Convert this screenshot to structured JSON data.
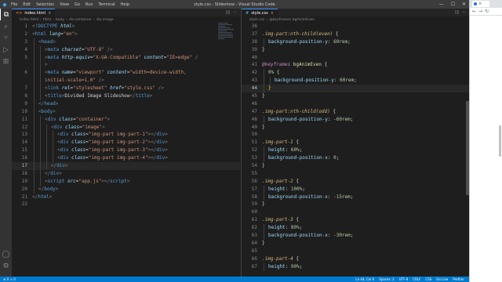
{
  "titlebar": {
    "logo_icon": "vscode-logo-icon",
    "menu": [
      "File",
      "Edit",
      "Selection",
      "View",
      "Go",
      "Run",
      "Terminal",
      "Help"
    ],
    "title": "style.css - Slideshow - Visual Studio Code",
    "controls": [
      "minimize-icon",
      "maximize-icon",
      "close-icon"
    ]
  },
  "activity_bar": {
    "top": [
      "files-icon",
      "search-icon",
      "source-control-icon",
      "run-debug-icon",
      "extensions-icon"
    ],
    "bottom": [
      "account-icon",
      "settings-gear-icon"
    ]
  },
  "left_editor": {
    "tab": {
      "icon_label": "<>",
      "label": "index.html"
    },
    "breadcrumbs": [
      "index.html",
      "html",
      "body",
      "div.container",
      "div.image"
    ],
    "current_line": 17,
    "lines": [
      {
        "n": 1,
        "indent": 0,
        "tokens": [
          [
            "p",
            "<!"
          ],
          [
            "t",
            "DOCTYPE"
          ],
          [
            "w",
            " "
          ],
          [
            "a",
            "html"
          ],
          [
            "p",
            ">"
          ]
        ]
      },
      {
        "n": 2,
        "indent": 0,
        "tokens": [
          [
            "p",
            "<"
          ],
          [
            "t",
            "html"
          ],
          [
            "w",
            " "
          ],
          [
            "a",
            "lang"
          ],
          [
            "w",
            "="
          ],
          [
            "s",
            "\"en\""
          ],
          [
            "p",
            ">"
          ]
        ]
      },
      {
        "n": 3,
        "indent": 1,
        "tokens": [
          [
            "p",
            "<"
          ],
          [
            "t",
            "head"
          ],
          [
            "p",
            ">"
          ]
        ]
      },
      {
        "n": 4,
        "indent": 2,
        "tokens": [
          [
            "p",
            "<"
          ],
          [
            "t",
            "meta"
          ],
          [
            "w",
            " "
          ],
          [
            "a",
            "charset"
          ],
          [
            "w",
            "="
          ],
          [
            "s",
            "\"UTF-8\""
          ],
          [
            "w",
            " "
          ],
          [
            "p",
            "/>"
          ]
        ]
      },
      {
        "n": 5,
        "indent": 2,
        "tokens": [
          [
            "p",
            "<"
          ],
          [
            "t",
            "meta"
          ],
          [
            "w",
            " "
          ],
          [
            "a",
            "http-equiv"
          ],
          [
            "w",
            "="
          ],
          [
            "s",
            "\"X-UA-Compatible\""
          ],
          [
            "w",
            " "
          ],
          [
            "a",
            "content"
          ],
          [
            "w",
            "="
          ],
          [
            "s",
            "\"IE=edge\""
          ],
          [
            "w",
            " "
          ],
          [
            "p",
            "/"
          ]
        ]
      },
      {
        "n": "",
        "indent": 2,
        "tokens": [
          [
            "p",
            ">"
          ]
        ]
      },
      {
        "n": 6,
        "indent": 2,
        "tokens": [
          [
            "p",
            "<"
          ],
          [
            "t",
            "meta"
          ],
          [
            "w",
            " "
          ],
          [
            "a",
            "name"
          ],
          [
            "w",
            "="
          ],
          [
            "s",
            "\"viewport\""
          ],
          [
            "w",
            " "
          ],
          [
            "a",
            "content"
          ],
          [
            "w",
            "="
          ],
          [
            "s",
            "\"width=device-width,"
          ]
        ]
      },
      {
        "n": "",
        "indent": 2,
        "tokens": [
          [
            "s",
            "initial-scale=1.0\""
          ],
          [
            "w",
            " "
          ],
          [
            "p",
            "/>"
          ]
        ]
      },
      {
        "n": 7,
        "indent": 2,
        "tokens": [
          [
            "p",
            "<"
          ],
          [
            "t",
            "link"
          ],
          [
            "w",
            " "
          ],
          [
            "a",
            "rel"
          ],
          [
            "w",
            "="
          ],
          [
            "s",
            "\"stylesheet\""
          ],
          [
            "w",
            " "
          ],
          [
            "a",
            "href"
          ],
          [
            "w",
            "="
          ],
          [
            "s",
            "\"style.css\""
          ],
          [
            "w",
            " "
          ],
          [
            "p",
            "/>"
          ]
        ]
      },
      {
        "n": 8,
        "indent": 2,
        "tokens": [
          [
            "p",
            "<"
          ],
          [
            "t",
            "title"
          ],
          [
            "p",
            ">"
          ],
          [
            "w",
            "Divided Image Slideshow"
          ],
          [
            "p",
            "</"
          ],
          [
            "t",
            "title"
          ],
          [
            "p",
            ">"
          ]
        ]
      },
      {
        "n": 9,
        "indent": 1,
        "tokens": [
          [
            "p",
            "</"
          ],
          [
            "t",
            "head"
          ],
          [
            "p",
            ">"
          ]
        ]
      },
      {
        "n": 10,
        "indent": 1,
        "tokens": [
          [
            "p",
            "<"
          ],
          [
            "t",
            "body"
          ],
          [
            "p",
            ">"
          ]
        ]
      },
      {
        "n": 11,
        "indent": 2,
        "tokens": [
          [
            "p",
            "<"
          ],
          [
            "t",
            "div"
          ],
          [
            "w",
            " "
          ],
          [
            "a",
            "class"
          ],
          [
            "w",
            "="
          ],
          [
            "s",
            "\"container\""
          ],
          [
            "p",
            ">"
          ]
        ]
      },
      {
        "n": 12,
        "indent": 3,
        "tokens": [
          [
            "p",
            "<"
          ],
          [
            "t",
            "div"
          ],
          [
            "w",
            " "
          ],
          [
            "a",
            "class"
          ],
          [
            "w",
            "="
          ],
          [
            "s",
            "\"image\""
          ],
          [
            "p",
            ">"
          ]
        ]
      },
      {
        "n": 13,
        "indent": 4,
        "tokens": [
          [
            "p",
            "<"
          ],
          [
            "t",
            "div"
          ],
          [
            "w",
            " "
          ],
          [
            "a",
            "class"
          ],
          [
            "w",
            "="
          ],
          [
            "s",
            "\"img-part img-part-1\""
          ],
          [
            "p",
            "></"
          ],
          [
            "t",
            "div"
          ],
          [
            "p",
            ">"
          ]
        ]
      },
      {
        "n": 14,
        "indent": 4,
        "tokens": [
          [
            "p",
            "<"
          ],
          [
            "t",
            "div"
          ],
          [
            "w",
            " "
          ],
          [
            "a",
            "class"
          ],
          [
            "w",
            "="
          ],
          [
            "s",
            "\"img-part img-part-2\""
          ],
          [
            "p",
            "></"
          ],
          [
            "t",
            "div"
          ],
          [
            "p",
            ">"
          ]
        ]
      },
      {
        "n": 15,
        "indent": 4,
        "tokens": [
          [
            "p",
            "<"
          ],
          [
            "t",
            "div"
          ],
          [
            "w",
            " "
          ],
          [
            "a",
            "class"
          ],
          [
            "w",
            "="
          ],
          [
            "s",
            "\"img-part img-part-3\""
          ],
          [
            "p",
            "></"
          ],
          [
            "t",
            "div"
          ],
          [
            "p",
            ">"
          ]
        ]
      },
      {
        "n": 16,
        "indent": 4,
        "tokens": [
          [
            "p",
            "<"
          ],
          [
            "t",
            "div"
          ],
          [
            "w",
            " "
          ],
          [
            "a",
            "class"
          ],
          [
            "w",
            "="
          ],
          [
            "s",
            "\"img-part img-part-4\""
          ],
          [
            "p",
            "></"
          ],
          [
            "t",
            "div"
          ],
          [
            "p",
            ">"
          ]
        ]
      },
      {
        "n": 17,
        "indent": 3,
        "tokens": [
          [
            "p",
            "</"
          ],
          [
            "t",
            "div"
          ],
          [
            "p",
            ">"
          ]
        ]
      },
      {
        "n": 18,
        "indent": 2,
        "tokens": [
          [
            "p",
            "</"
          ],
          [
            "t",
            "div"
          ],
          [
            "p",
            ">"
          ]
        ]
      },
      {
        "n": 19,
        "indent": 2,
        "tokens": [
          [
            "p",
            "<"
          ],
          [
            "t",
            "script"
          ],
          [
            "w",
            " "
          ],
          [
            "a",
            "src"
          ],
          [
            "w",
            "="
          ],
          [
            "s",
            "\"app.js\""
          ],
          [
            "p",
            "></"
          ],
          [
            "t",
            "script"
          ],
          [
            "p",
            ">"
          ]
        ]
      },
      {
        "n": 20,
        "indent": 1,
        "tokens": [
          [
            "p",
            "</"
          ],
          [
            "t",
            "body"
          ],
          [
            "p",
            ">"
          ]
        ]
      },
      {
        "n": 21,
        "indent": 0,
        "tokens": [
          [
            "p",
            "</"
          ],
          [
            "t",
            "html"
          ],
          [
            "p",
            ">"
          ]
        ]
      },
      {
        "n": 22,
        "indent": 0,
        "tokens": []
      }
    ]
  },
  "right_editor": {
    "tab": {
      "icon_label": "#",
      "label": "style.css"
    },
    "breadcrumbs": [
      "style.css",
      "@keyframes bgAnimEven"
    ],
    "current_line": 44,
    "lines": [
      {
        "n": 36,
        "indent": 0,
        "tokens": []
      },
      {
        "n": 37,
        "indent": 0,
        "tokens": [
          [
            "sel",
            ".img-part:nth-child(even)"
          ],
          [
            "w",
            " {"
          ]
        ]
      },
      {
        "n": 38,
        "indent": 1,
        "tokens": [
          [
            "pr",
            "background-position-y"
          ],
          [
            "w",
            ": "
          ],
          [
            "n",
            "60rem"
          ],
          [
            "w",
            ";"
          ]
        ]
      },
      {
        "n": 39,
        "indent": 0,
        "tokens": [
          [
            "w",
            "}"
          ]
        ]
      },
      {
        "n": 40,
        "indent": 0,
        "tokens": []
      },
      {
        "n": 41,
        "indent": 0,
        "tokens": [
          [
            "k",
            "@keyframes"
          ],
          [
            "w",
            " "
          ],
          [
            "fn",
            "bgAnimEven"
          ],
          [
            "w",
            " {"
          ]
        ]
      },
      {
        "n": 42,
        "indent": 1,
        "tokens": [
          [
            "n",
            "0%"
          ],
          [
            "w",
            " {"
          ]
        ]
      },
      {
        "n": 43,
        "indent": 2,
        "tokens": [
          [
            "pr",
            "background-position-y"
          ],
          [
            "w",
            ": "
          ],
          [
            "n",
            "60rem"
          ],
          [
            "w",
            ";"
          ]
        ]
      },
      {
        "n": 44,
        "indent": 1,
        "tokens": [
          [
            "br",
            "}"
          ]
        ]
      },
      {
        "n": 45,
        "indent": 0,
        "tokens": [
          [
            "w",
            "}"
          ]
        ]
      },
      {
        "n": 46,
        "indent": 0,
        "tokens": []
      },
      {
        "n": 47,
        "indent": 0,
        "tokens": [
          [
            "sel",
            ".img-part:nth-child(odd)"
          ],
          [
            "w",
            " {"
          ]
        ]
      },
      {
        "n": 48,
        "indent": 1,
        "tokens": [
          [
            "pr",
            "background-position-y"
          ],
          [
            "w",
            ": "
          ],
          [
            "n",
            "-60rem"
          ],
          [
            "w",
            ";"
          ]
        ]
      },
      {
        "n": 49,
        "indent": 0,
        "tokens": [
          [
            "w",
            "}"
          ]
        ]
      },
      {
        "n": 50,
        "indent": 0,
        "tokens": []
      },
      {
        "n": 51,
        "indent": 0,
        "tokens": [
          [
            "sel",
            ".img-part-1"
          ],
          [
            "w",
            " {"
          ]
        ]
      },
      {
        "n": 52,
        "indent": 1,
        "tokens": [
          [
            "pr",
            "height"
          ],
          [
            "w",
            ": "
          ],
          [
            "n",
            "60%"
          ],
          [
            "w",
            ";"
          ]
        ]
      },
      {
        "n": 53,
        "indent": 1,
        "tokens": [
          [
            "pr",
            "background-position-x"
          ],
          [
            "w",
            ": "
          ],
          [
            "n",
            "0"
          ],
          [
            "w",
            ";"
          ]
        ]
      },
      {
        "n": 54,
        "indent": 0,
        "tokens": [
          [
            "w",
            "}"
          ]
        ]
      },
      {
        "n": 55,
        "indent": 0,
        "tokens": []
      },
      {
        "n": 56,
        "indent": 0,
        "tokens": [
          [
            "sel",
            ".img-part-2"
          ],
          [
            "w",
            " {"
          ]
        ]
      },
      {
        "n": 57,
        "indent": 1,
        "tokens": [
          [
            "pr",
            "height"
          ],
          [
            "w",
            ": "
          ],
          [
            "n",
            "100%"
          ],
          [
            "w",
            ";"
          ]
        ]
      },
      {
        "n": 58,
        "indent": 1,
        "tokens": [
          [
            "pr",
            "background-position-x"
          ],
          [
            "w",
            ": "
          ],
          [
            "n",
            "-15rem"
          ],
          [
            "w",
            ";"
          ]
        ]
      },
      {
        "n": 59,
        "indent": 0,
        "tokens": [
          [
            "w",
            "}"
          ]
        ]
      },
      {
        "n": 60,
        "indent": 0,
        "tokens": []
      },
      {
        "n": 61,
        "indent": 0,
        "tokens": [
          [
            "sel",
            ".img-part-3"
          ],
          [
            "w",
            " {"
          ]
        ]
      },
      {
        "n": 62,
        "indent": 1,
        "tokens": [
          [
            "pr",
            "height"
          ],
          [
            "w",
            ": "
          ],
          [
            "n",
            "80%"
          ],
          [
            "w",
            ";"
          ]
        ]
      },
      {
        "n": 63,
        "indent": 1,
        "tokens": [
          [
            "pr",
            "background-position-x"
          ],
          [
            "w",
            ": "
          ],
          [
            "n",
            "-30rem"
          ],
          [
            "w",
            ";"
          ]
        ]
      },
      {
        "n": 64,
        "indent": 0,
        "tokens": [
          [
            "w",
            "}"
          ]
        ]
      },
      {
        "n": 65,
        "indent": 0,
        "tokens": []
      },
      {
        "n": 66,
        "indent": 0,
        "tokens": [
          [
            "sel",
            ".img-part-4"
          ],
          [
            "w",
            " {"
          ]
        ]
      },
      {
        "n": 67,
        "indent": 1,
        "tokens": [
          [
            "pr",
            "height"
          ],
          [
            "w",
            ": "
          ],
          [
            "n",
            "90%"
          ],
          [
            "w",
            ";"
          ]
        ]
      }
    ]
  },
  "statusbar": {
    "left": [
      "⊗ 0 ⚠ 0"
    ],
    "right": [
      "Ln 44, Col 6",
      "Spaces: 2",
      "UTF-8",
      "CRLF",
      "CSS",
      "Go Live",
      "Prettier"
    ]
  },
  "browser": {
    "tab_label": "",
    "nav": [
      "back-icon",
      "forward-icon",
      "reload-icon"
    ]
  },
  "colors": {
    "editor_bg": "#1e1e1e",
    "statusbar": "#007acc",
    "titlebar": "#3c3c3c",
    "activity_bar": "#333333"
  }
}
